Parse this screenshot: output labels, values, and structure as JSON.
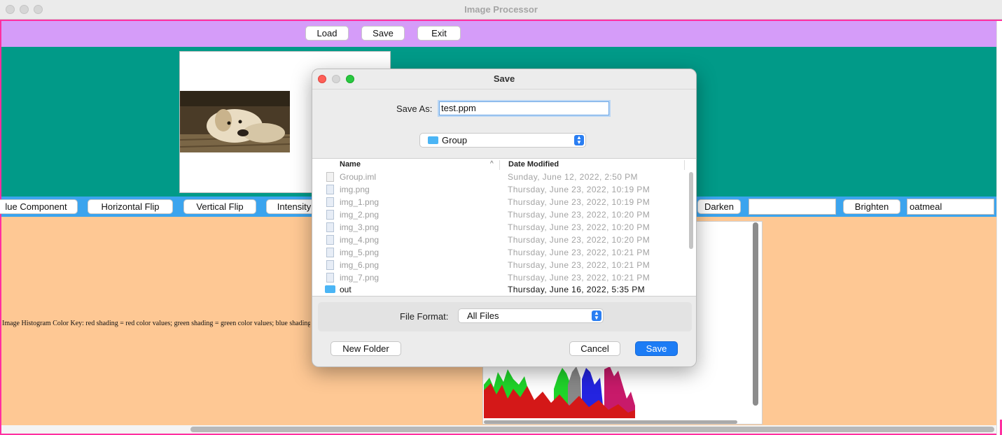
{
  "window": {
    "title": "Image Processor"
  },
  "toolbar": {
    "load_label": "Load",
    "save_label": "Save",
    "exit_label": "Exit"
  },
  "operations": {
    "blue_component_label": "lue Component",
    "horizontal_flip_label": "Horizontal Flip",
    "vertical_flip_label": "Vertical Flip",
    "intensity_label": "Intensity",
    "darken_label": "Darken",
    "darken_value": "",
    "brighten_label": "Brighten",
    "brighten_value": "oatmeal"
  },
  "histogram": {
    "key_text": "Image Histogram Color Key: red shading = red color values; green shading = green color values; blue shading = blue color values"
  },
  "dialog": {
    "title": "Save",
    "save_as_label": "Save As:",
    "save_as_value": "test.ppm",
    "location": "Group",
    "columns": {
      "name": "Name",
      "date_modified": "Date Modified"
    },
    "files": [
      {
        "name": "Group.iml",
        "date": "Sunday, June 12, 2022, 2:50 PM",
        "icon": "document-icon"
      },
      {
        "name": "img.png",
        "date": "Thursday, June 23, 2022, 10:19 PM",
        "icon": "image-file-icon"
      },
      {
        "name": "img_1.png",
        "date": "Thursday, June 23, 2022, 10:19 PM",
        "icon": "image-file-icon"
      },
      {
        "name": "img_2.png",
        "date": "Thursday, June 23, 2022, 10:20 PM",
        "icon": "image-file-icon"
      },
      {
        "name": "img_3.png",
        "date": "Thursday, June 23, 2022, 10:20 PM",
        "icon": "image-file-icon"
      },
      {
        "name": "img_4.png",
        "date": "Thursday, June 23, 2022, 10:20 PM",
        "icon": "image-file-icon"
      },
      {
        "name": "img_5.png",
        "date": "Thursday, June 23, 2022, 10:21 PM",
        "icon": "image-file-icon"
      },
      {
        "name": "img_6.png",
        "date": "Thursday, June 23, 2022, 10:21 PM",
        "icon": "image-file-icon"
      },
      {
        "name": "img_7.png",
        "date": "Thursday, June 23, 2022, 10:21 PM",
        "icon": "image-file-icon"
      },
      {
        "name": "out",
        "date": "Thursday, June 16, 2022, 5:35 PM",
        "icon": "folder-icon"
      }
    ],
    "file_format_label": "File Format:",
    "file_format_value": "All Files",
    "new_folder_label": "New Folder",
    "cancel_label": "Cancel",
    "save_label": "Save"
  },
  "colors": {
    "toolbar_bg": "#d59cf9",
    "image_area_bg": "#019a88",
    "ops_bar_bg": "#3ba4ee",
    "histogram_area_bg": "#fec894",
    "frame_border": "#ff2fa0",
    "primary_button": "#1c7cf5"
  }
}
